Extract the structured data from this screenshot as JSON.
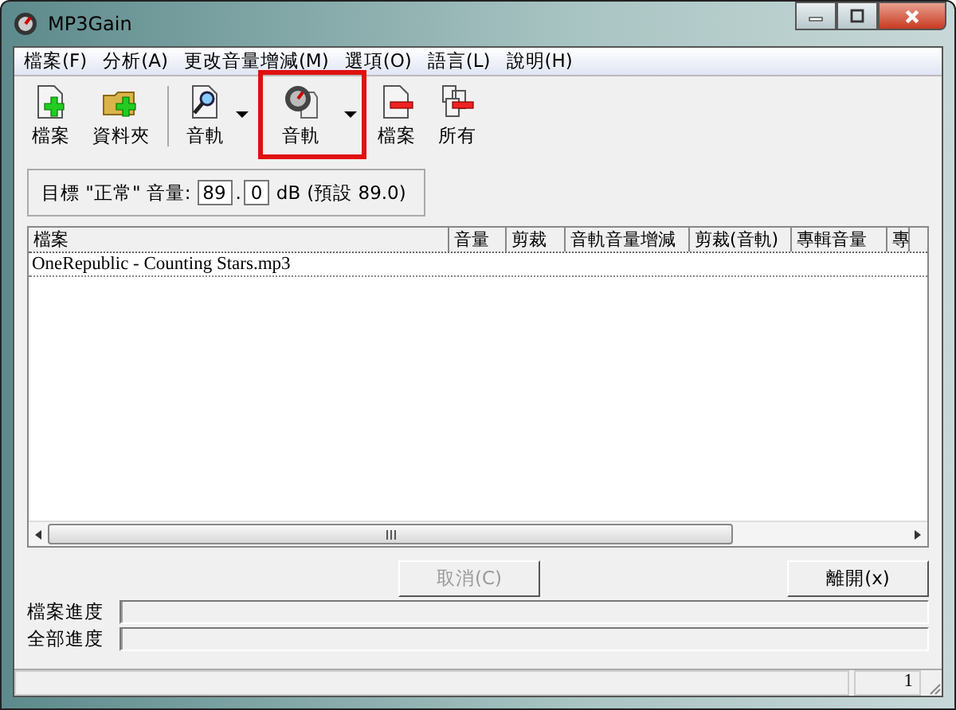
{
  "window": {
    "title": "MP3Gain"
  },
  "menu": [
    {
      "label": "檔案(F)"
    },
    {
      "label": "分析(A)"
    },
    {
      "label": "更改音量增減(M)"
    },
    {
      "label": "選項(O)"
    },
    {
      "label": "語言(L)"
    },
    {
      "label": "說明(H)"
    }
  ],
  "toolbar": [
    {
      "label": "檔案",
      "kind": "add-file",
      "dropdown": false,
      "highlighted": false,
      "separator_after": false
    },
    {
      "label": "資料夾",
      "kind": "add-folder",
      "dropdown": false,
      "highlighted": false,
      "separator_after": true
    },
    {
      "label": "音軌",
      "kind": "analyze",
      "dropdown": true,
      "highlighted": false,
      "separator_after": false
    },
    {
      "label": "音軌",
      "kind": "gain",
      "dropdown": true,
      "highlighted": true,
      "separator_after": false
    },
    {
      "label": "檔案",
      "kind": "remove-file",
      "dropdown": false,
      "highlighted": false,
      "separator_after": false
    },
    {
      "label": "所有",
      "kind": "remove-all",
      "dropdown": false,
      "highlighted": false,
      "separator_after": false
    }
  ],
  "target": {
    "label": "目標 \"正常\" 音量:",
    "integer": "89",
    "separator": ".",
    "decimal": "0",
    "unit": "dB",
    "default": "(預設 89.0)"
  },
  "table": {
    "columns": [
      "檔案",
      "音量",
      "剪裁",
      "音軌音量增減",
      "剪裁(音軌)",
      "專輯音量",
      "專"
    ],
    "rows": [
      {
        "file": "OneRepublic - Counting Stars.mp3",
        "selected": false
      }
    ]
  },
  "buttons": [
    {
      "label": "取消(C)",
      "disabled": true
    },
    {
      "label": "離開(x)",
      "disabled": false
    }
  ],
  "progress": [
    {
      "label": "檔案進度",
      "level": 0
    },
    {
      "label": "全部進度",
      "level": 0
    }
  ],
  "status_bar": {
    "count": "1"
  }
}
